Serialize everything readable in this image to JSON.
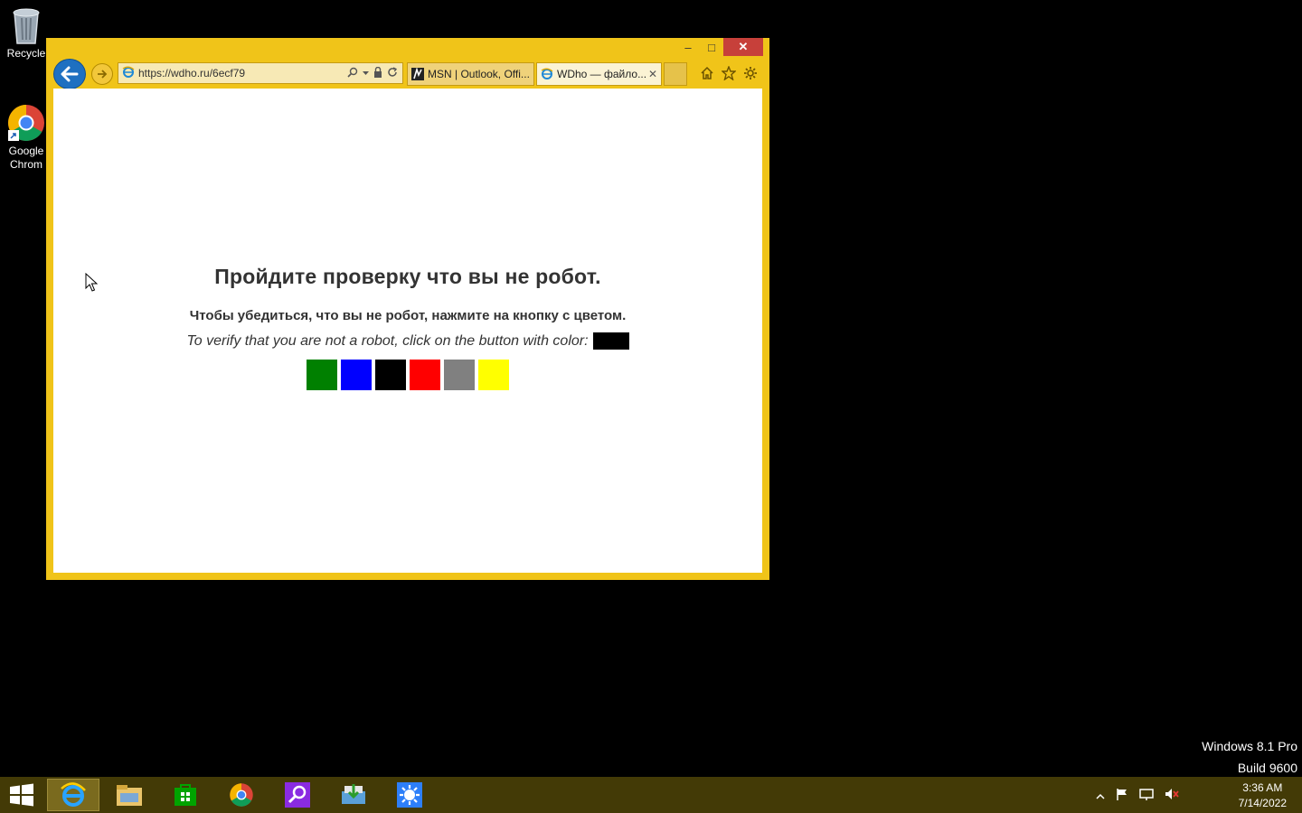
{
  "desktop": {
    "icons": [
      {
        "label": "Recycle"
      },
      {
        "label": "Google Chrom"
      }
    ],
    "version_line1": "Windows 8.1 Pro",
    "version_line2": "Build 9600"
  },
  "browser": {
    "address": "https://wdho.ru/6ecf79",
    "tabs": [
      {
        "label": "MSN | Outlook, Offi...",
        "active": false
      },
      {
        "label": "WDho — файло...",
        "active": true
      }
    ],
    "close_glyph": "✕",
    "minimize_glyph": "–",
    "maximize_glyph": "□"
  },
  "page": {
    "title": "Пройдите проверку что вы не робот.",
    "instruction_ru": "Чтобы убедиться, что вы не робот, нажмите на кнопку с цветом.",
    "instruction_en": "To verify that you are not a robot, click on the button with color:",
    "target_color": "#000000",
    "color_buttons": [
      "#008000",
      "#0000ff",
      "#000000",
      "#ff0000",
      "#808080",
      "#ffff00"
    ]
  },
  "taskbar": {
    "apps": [
      "internet-explorer-icon",
      "file-explorer-icon",
      "store-icon",
      "chrome-icon",
      "search-app-icon",
      "install-app-icon",
      "settings-app-icon"
    ],
    "time": "3:36 AM",
    "date": "7/14/2022"
  },
  "colors": {
    "window_frame": "#f0c419",
    "taskbar": "#433a06",
    "close_button": "#c7403a"
  }
}
